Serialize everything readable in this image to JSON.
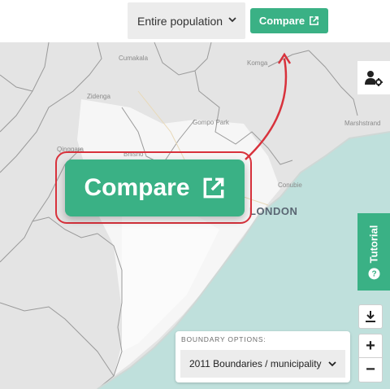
{
  "header": {
    "population_select": "Entire population",
    "compare_label": "Compare"
  },
  "map": {
    "places": {
      "cumakala": "Cumakala",
      "komga": "Komga",
      "zidenga": "Zidenga",
      "compo_park": "Gompo Park",
      "marshstrand": "Marshstrand",
      "qingqara": "Qingqara",
      "bhisho": "Bhisho",
      "conubie": "Conubie"
    },
    "city": "LONDON"
  },
  "callout": {
    "compare_label": "Compare"
  },
  "controls": {
    "tutorial_label": "Tutorial",
    "zoom_in": "+",
    "zoom_out": "−"
  },
  "boundary": {
    "title": "BOUNDARY OPTIONS:",
    "selected": "2011 Boundaries / municipality"
  },
  "colors": {
    "accent": "#3ab185",
    "highlight": "#d8323c",
    "sea": "#bfe0dc",
    "land": "#e6e6e6"
  },
  "icons": [
    "chevron-down-icon",
    "external-link-icon",
    "user-settings-icon",
    "question-icon",
    "download-icon"
  ]
}
